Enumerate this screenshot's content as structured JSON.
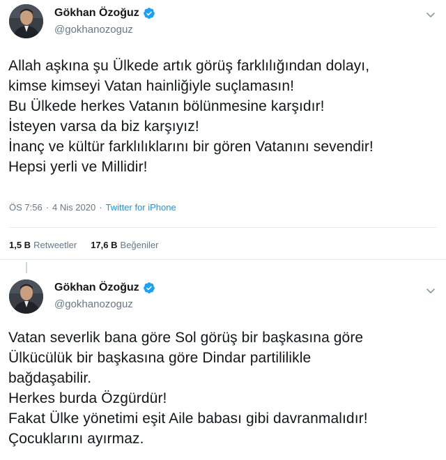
{
  "tweets": [
    {
      "author": {
        "display_name": "Gökhan Özoğuz",
        "handle": "@gokhanozoguz",
        "verified_icon": "verified-badge-icon",
        "avatar_icon": "profile-photo"
      },
      "text": "Allah aşkına şu Ülkede artık görüş farklılığından dolayı,\nkimse kimseyi Vatan hainliğiyle suçlamasın!\nBu Ülkede herkes Vatanın bölünmesine karşıdır!\nİsteyen varsa da biz karşıyız!\nİnanç ve kültür farklılıklarını bir gören Vatanını sevendir!\nHepsi yerli ve Millidir!",
      "time": "ÖS 7:56",
      "separator": "·",
      "date": "4 Nis 2020",
      "source": "Twitter for iPhone",
      "retweets": {
        "count": "1,5 B",
        "label": "Retweetler"
      },
      "likes": {
        "count": "17,6 B",
        "label": "Beğeniler"
      }
    },
    {
      "author": {
        "display_name": "Gökhan Özoğuz",
        "handle": "@gokhanozoguz",
        "verified_icon": "verified-badge-icon",
        "avatar_icon": "profile-photo"
      },
      "text": "Vatan severlik bana göre Sol görüş bir başkasına göre\nÜlkücülük bir başkasına göre Dindar partililikle\nbağdaşabilir.\nHerkes burda Özgürdür!\nFakat Ülke yönetimi eşit Aile babası gibi davranmalıdır!\nÇocuklarını ayırmaz."
    }
  ],
  "colors": {
    "text": "#14171a",
    "secondary": "#657786",
    "link": "#1b95e0",
    "verified": "#1da1f2",
    "divider": "#e6ecf0"
  }
}
